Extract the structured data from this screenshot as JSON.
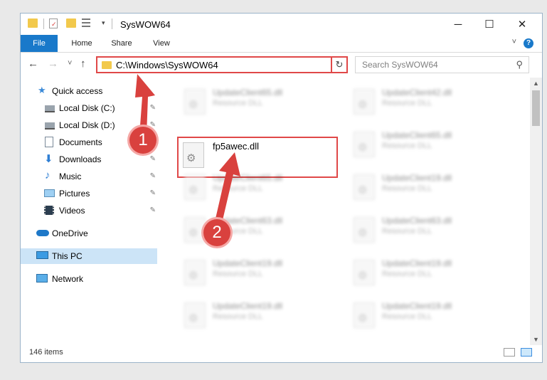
{
  "window": {
    "title": "SysWOW64",
    "controls": {
      "minimize": "─",
      "maximize": "☐",
      "close": "✕"
    }
  },
  "ribbon": {
    "tabs": [
      "File",
      "Home",
      "Share",
      "View"
    ],
    "help": "?"
  },
  "nav": {
    "back": "←",
    "forward": "→",
    "recent": "˅",
    "up": "↑"
  },
  "address": {
    "path": "C:\\Windows\\SysWOW64",
    "dropdown": "˅",
    "refresh": "↻"
  },
  "search": {
    "placeholder": "Search SysWOW64",
    "icon": "⚲"
  },
  "sidebar": {
    "items": [
      {
        "label": "Quick access",
        "icon": "star-icon",
        "pinned": false
      },
      {
        "label": "Local Disk (C:)",
        "icon": "drive-icon",
        "pinned": true
      },
      {
        "label": "Local Disk (D:)",
        "icon": "drive-icon",
        "pinned": true
      },
      {
        "label": "Documents",
        "icon": "documents-icon",
        "pinned": true
      },
      {
        "label": "Downloads",
        "icon": "download-icon",
        "pinned": true
      },
      {
        "label": "Music",
        "icon": "music-icon",
        "pinned": true
      },
      {
        "label": "Pictures",
        "icon": "pictures-icon",
        "pinned": true
      },
      {
        "label": "Videos",
        "icon": "videos-icon",
        "pinned": true
      },
      {
        "label": "OneDrive",
        "icon": "cloud-icon",
        "pinned": false
      },
      {
        "label": "This PC",
        "icon": "computer-icon",
        "pinned": false,
        "selected": true
      },
      {
        "label": "Network",
        "icon": "network-icon",
        "pinned": false
      }
    ],
    "pin_glyph": "📌"
  },
  "files": {
    "highlighted": {
      "name": "fp5awec.dll",
      "type": ""
    },
    "blurred": [
      {
        "name": "UpdateClient65.dll",
        "type": "Resource DLL"
      },
      {
        "name": "UpdateClient42.dll",
        "type": "Resource DLL"
      },
      {
        "name": "UpdateClient65.dll",
        "type": "Resource DLL"
      },
      {
        "name": "UpdateClient65.dll",
        "type": "Resource DLL"
      },
      {
        "name": "UpdateClient19.dll",
        "type": "Resource DLL"
      },
      {
        "name": "UpdateClient63.dll",
        "type": "Resource DLL"
      },
      {
        "name": "UpdateClient63.dll",
        "type": "Resource DLL"
      },
      {
        "name": "UpdateClient19.dll",
        "type": "Resource DLL"
      },
      {
        "name": "UpdateClient19.dll",
        "type": "Resource DLL"
      },
      {
        "name": "UpdateClient19.dll",
        "type": "Resource DLL"
      },
      {
        "name": "UpdateClient19.dll",
        "type": "Resource DLL"
      }
    ]
  },
  "status": {
    "count": "146 items"
  },
  "annotations": {
    "step1": "1",
    "step2": "2",
    "color": "#d9413e"
  }
}
